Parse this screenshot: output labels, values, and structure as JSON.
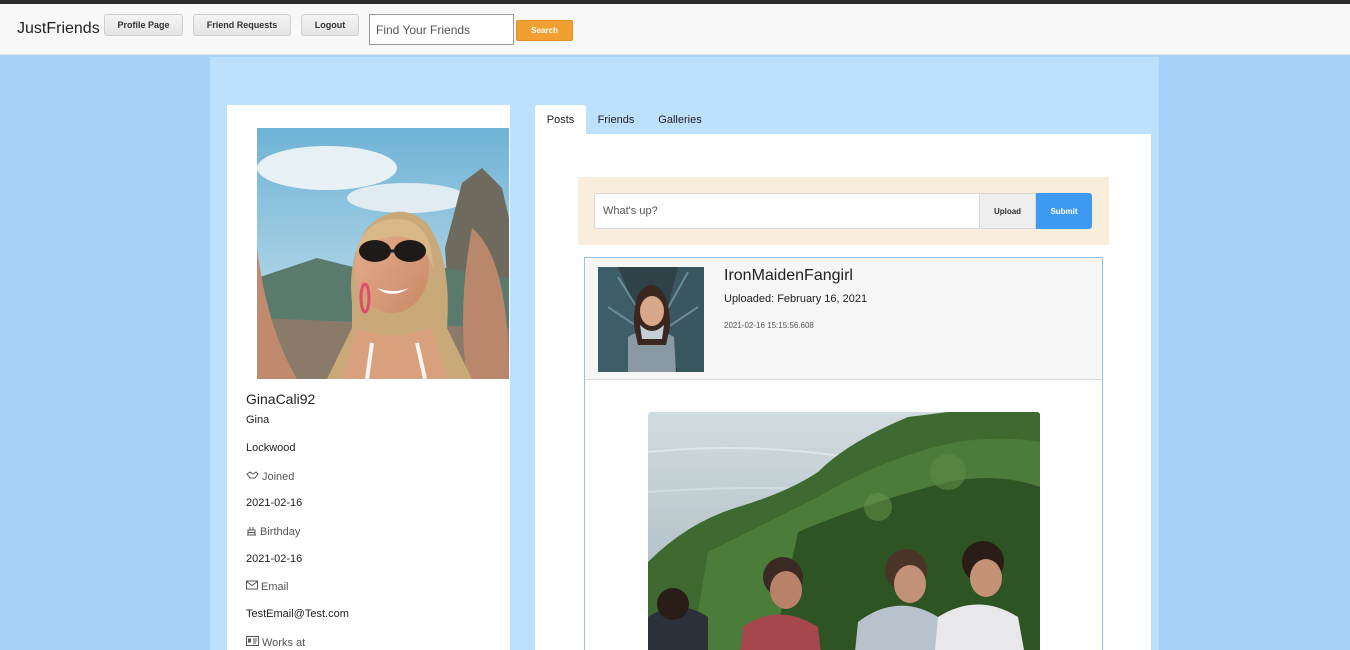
{
  "nav": {
    "brand": "JustFriends",
    "profile_page": "Profile Page",
    "friend_requests": "Friend Requests",
    "logout": "Logout",
    "search_placeholder": "Find Your Friends",
    "search_button": "Search"
  },
  "profile": {
    "username": "GinaCali92",
    "first_name": "Gina",
    "last_name": "Lockwood",
    "joined_label": "Joined",
    "joined_icon": "handshake-icon",
    "joined_value": "2021-02-16",
    "birthday_label": "Birthday",
    "birthday_icon": "cake-icon",
    "birthday_value": "2021-02-16",
    "email_label": "Email",
    "email_icon": "envelope-icon",
    "email_value": "TestEmail@Test.com",
    "works_label": "Works at",
    "works_icon": "id-card-icon"
  },
  "tabs": {
    "posts": "Posts",
    "friends": "Friends",
    "galleries": "Galleries",
    "active": "posts"
  },
  "compose": {
    "placeholder": "What's up?",
    "upload": "Upload",
    "submit": "Submit"
  },
  "post": {
    "author": "IronMaidenFangirl",
    "uploaded": "Uploaded: February 16, 2021",
    "timestamp": "2021-02-16 15:15:56.608"
  },
  "colors": {
    "page_bg": "#a6d2f7",
    "panel_bg": "#bde0fc",
    "search_btn": "#f0a032",
    "submit_btn": "#3d9af0",
    "compose_bg": "#f8eedb"
  }
}
